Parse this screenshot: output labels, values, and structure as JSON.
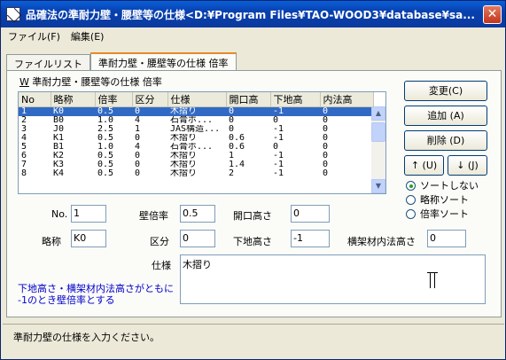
{
  "window": {
    "title": "品確法の準耐力壁・腰壁等の仕様<D:¥Program Files¥TAO-WOOD3¥database¥sa..."
  },
  "menu": [
    "ファイル(F)",
    "編集(E)"
  ],
  "tabs": [
    "ファイルリスト",
    "準耐力壁・腰壁等の仕様 倍率"
  ],
  "group_label": "準耐力壁・腰壁等の仕様 倍率",
  "group_mnemonic": "W",
  "table": {
    "columns": [
      "No",
      "略称",
      "倍率",
      "区分",
      "仕様",
      "開口高",
      "下地高",
      "内法高"
    ],
    "rows": [
      [
        "1",
        "K0",
        "0.5",
        "0",
        "木摺り",
        "0",
        "-1",
        "0"
      ],
      [
        "2",
        "B0",
        "1.0",
        "4",
        "石膏ボ...",
        "0",
        "0",
        "0"
      ],
      [
        "3",
        "J0",
        "2.5",
        "1",
        "JAS構造...",
        "0",
        "-1",
        "0"
      ],
      [
        "4",
        "K1",
        "0.5",
        "0",
        "木摺り",
        "0.6",
        "-1",
        "0"
      ],
      [
        "5",
        "B1",
        "1.0",
        "4",
        "石膏ボ...",
        "0.6",
        "0",
        "0"
      ],
      [
        "6",
        "K2",
        "0.5",
        "0",
        "木摺り",
        "1",
        "-1",
        "0"
      ],
      [
        "7",
        "K3",
        "0.5",
        "0",
        "木摺り",
        "1.4",
        "-1",
        "0"
      ],
      [
        "8",
        "K4",
        "0.5",
        "0",
        "木摺り",
        "2",
        "-1",
        "0"
      ]
    ],
    "selected_index": 0
  },
  "buttons": {
    "change": "変更(C)",
    "add": "追加 (A)",
    "delete": "削除 (D)",
    "up": "↑ (U)",
    "down": "↓ (J)"
  },
  "sort_options": [
    {
      "label": "ソートしない",
      "checked": true
    },
    {
      "label": "略称ソート",
      "checked": false
    },
    {
      "label": "倍率ソート",
      "checked": false
    }
  ],
  "fields": {
    "no_label": "No.",
    "no_value": "1",
    "ratio_label": "壁倍率",
    "ratio_value": "0.5",
    "opening_label": "開口高さ",
    "opening_value": "0",
    "abbr_label": "略称",
    "abbr_value": "K0",
    "category_label": "区分",
    "category_value": "0",
    "base_label": "下地高さ",
    "base_value": "-1",
    "inner_label": "横架材内法高さ",
    "inner_value": "0",
    "spec_label": "仕様",
    "spec_value": "木摺り"
  },
  "note": [
    "下地高さ・横架材内法高さがともに",
    "-1のとき壁倍率とする"
  ],
  "status": "準耐力壁の仕様を入力ください。"
}
